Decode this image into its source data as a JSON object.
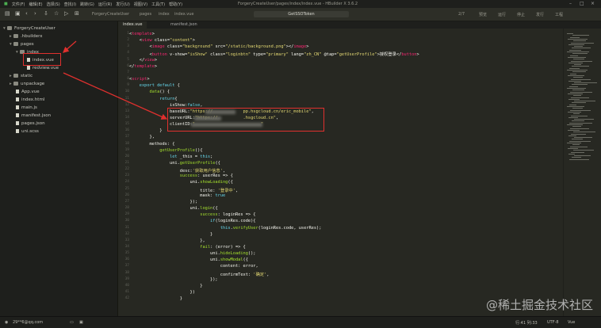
{
  "menu": [
    "文件(F)",
    "编辑(E)",
    "选择(S)",
    "查找(I)",
    "跳转(G)",
    "运行(R)",
    "发行(U)",
    "视图(V)",
    "工具(T)",
    "帮助(Y)"
  ],
  "window_title": "ForgeryCreateUser/pages/index/index.vue - HBuilder X 3.6.2",
  "breadcrumb": [
    "ForgeryCreateUser",
    "pages",
    "index",
    "index.vue"
  ],
  "search_value": "GetSSOToken",
  "toolbar_right": [
    "2/7",
    "预览",
    "运行",
    "停止",
    "发行",
    "工程"
  ],
  "explorer": {
    "items": [
      {
        "label": "ForgeryCreateUser",
        "depth": 0,
        "type": "folder"
      },
      {
        "label": ".hbuilderx",
        "depth": 1,
        "type": "folder"
      },
      {
        "label": "pages",
        "depth": 1,
        "type": "folder"
      },
      {
        "label": "index",
        "depth": 2,
        "type": "folder"
      },
      {
        "label": "index.vue",
        "depth": 3,
        "type": "file"
      },
      {
        "label": "redview.vue",
        "depth": 3,
        "type": "file"
      },
      {
        "label": "static",
        "depth": 1,
        "type": "folder"
      },
      {
        "label": "unpackage",
        "depth": 1,
        "type": "folder"
      },
      {
        "label": "App.vue",
        "depth": 1,
        "type": "file"
      },
      {
        "label": "index.html",
        "depth": 1,
        "type": "file"
      },
      {
        "label": "main.js",
        "depth": 1,
        "type": "file"
      },
      {
        "label": "manifest.json",
        "depth": 1,
        "type": "file"
      },
      {
        "label": "pages.json",
        "depth": 1,
        "type": "file"
      },
      {
        "label": "uni.scss",
        "depth": 1,
        "type": "file"
      }
    ]
  },
  "tabs": [
    "index.vue",
    "manifest.json"
  ],
  "code_lines": [
    {
      "n": "1",
      "t": "<template>"
    },
    {
      "n": "2",
      "t": "    <view class=\"content\">"
    },
    {
      "n": "3",
      "t": "        <image class=\"background\" src=\"/static/background.png\"></image>"
    },
    {
      "n": "4",
      "t": "        <button v-show=\"isShow\" class=\"loginbtn\" type=\"primary\" lang=\"zh_CN\" @tap=\"getUserProfile\">授权登录</button>"
    },
    {
      "n": "5",
      "t": "    </view>"
    },
    {
      "n": "6",
      "t": "</template>"
    },
    {
      "n": "7",
      "t": ""
    },
    {
      "n": "8",
      "t": "<script>"
    },
    {
      "n": "9",
      "t": "    export default {"
    },
    {
      "n": "10",
      "t": "        data() {"
    },
    {
      "n": "11",
      "t": "            return{"
    },
    {
      "n": "12",
      "t": "                isShow:false,"
    },
    {
      "n": "13",
      "t": "                baseURL:\"https://            pp.hsgcloud.cn/eric_mobile\","
    },
    {
      "n": "14",
      "t": "                serverURL:\"https://          .hsgcloud.cn\","
    },
    {
      "n": "15",
      "t": "                clientID:\"                          \""
    },
    {
      "n": "16",
      "t": "            }"
    },
    {
      "n": "17",
      "t": "        },"
    },
    {
      "n": "18",
      "t": "        methods: {"
    },
    {
      "n": "19",
      "t": "            getUserProfile(){"
    },
    {
      "n": "20",
      "t": "                let _this = this;"
    },
    {
      "n": "21",
      "t": "                uni.getUserProfile({"
    },
    {
      "n": "22",
      "t": "                    desc:'获取用户信息',"
    },
    {
      "n": "23",
      "t": "                    success: userRes => {"
    },
    {
      "n": "24",
      "t": "                        uni.showLoading({"
    },
    {
      "n": "25",
      "t": "                            title: '登录中',"
    },
    {
      "n": "26",
      "t": "                            mask: true"
    },
    {
      "n": "27",
      "t": "                        });"
    },
    {
      "n": "28",
      "t": "                        uni.login({"
    },
    {
      "n": "29",
      "t": "                            success: loginRes => {"
    },
    {
      "n": "30",
      "t": "                                if(loginRes.code){"
    },
    {
      "n": "31",
      "t": "                                    this.verifyUser(loginRes.code, userRes);"
    },
    {
      "n": "32",
      "t": "                                }"
    },
    {
      "n": "33",
      "t": "                            },"
    },
    {
      "n": "34",
      "t": "                            fail: (error) => {"
    },
    {
      "n": "35",
      "t": "                                uni.hideLoading();"
    },
    {
      "n": "36",
      "t": "                                uni.showModal({"
    },
    {
      "n": "37",
      "t": "                                    content: error,"
    },
    {
      "n": "38",
      "t": "                                    confirmText: '确定',"
    },
    {
      "n": "39",
      "t": "                                });"
    },
    {
      "n": "40",
      "t": "                            }"
    },
    {
      "n": "41",
      "t": "                        })"
    },
    {
      "n": "42",
      "t": "                    }"
    }
  ],
  "status": {
    "left": "29**6@qq.com",
    "position": "行:41  列:33",
    "encoding": "UTF-8",
    "language": "Vue"
  },
  "watermark": "@稀土掘金技术社区",
  "colors": {
    "annotation_red": "#e0302e",
    "editor_bg": "#272822"
  }
}
